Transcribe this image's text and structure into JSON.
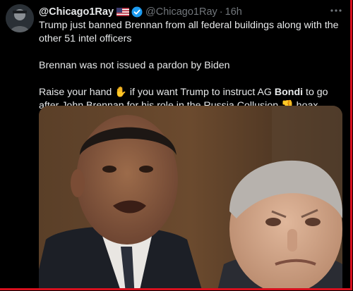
{
  "tweet": {
    "display_name": "@Chicago1Ray",
    "handle": "@Chicago1Ray",
    "separator": "·",
    "time": "16h",
    "line1": "Trump just banned Brennan from all federal buildings along with the other 51 intel officers",
    "line2": "Brennan was not issued a pardon by Biden",
    "line3_a": "Raise your hand ",
    "hand_emoji": "✋",
    "line3_b": " if you want Trump to instruct AG ",
    "bold_name": "Bondi",
    "line3_c": " to go after John Brennan for his role in the Russia Collusion ",
    "point_emoji": "👎",
    "line3_d": " hoax"
  },
  "colors": {
    "background": "#000000",
    "text": "#e7e9ea",
    "muted": "#71767b",
    "verified": "#1d9bf0",
    "border": "#d80f1d"
  },
  "icons": {
    "flag": "us-flag-icon",
    "verified": "verified-badge-icon",
    "more": "more-options-icon"
  }
}
